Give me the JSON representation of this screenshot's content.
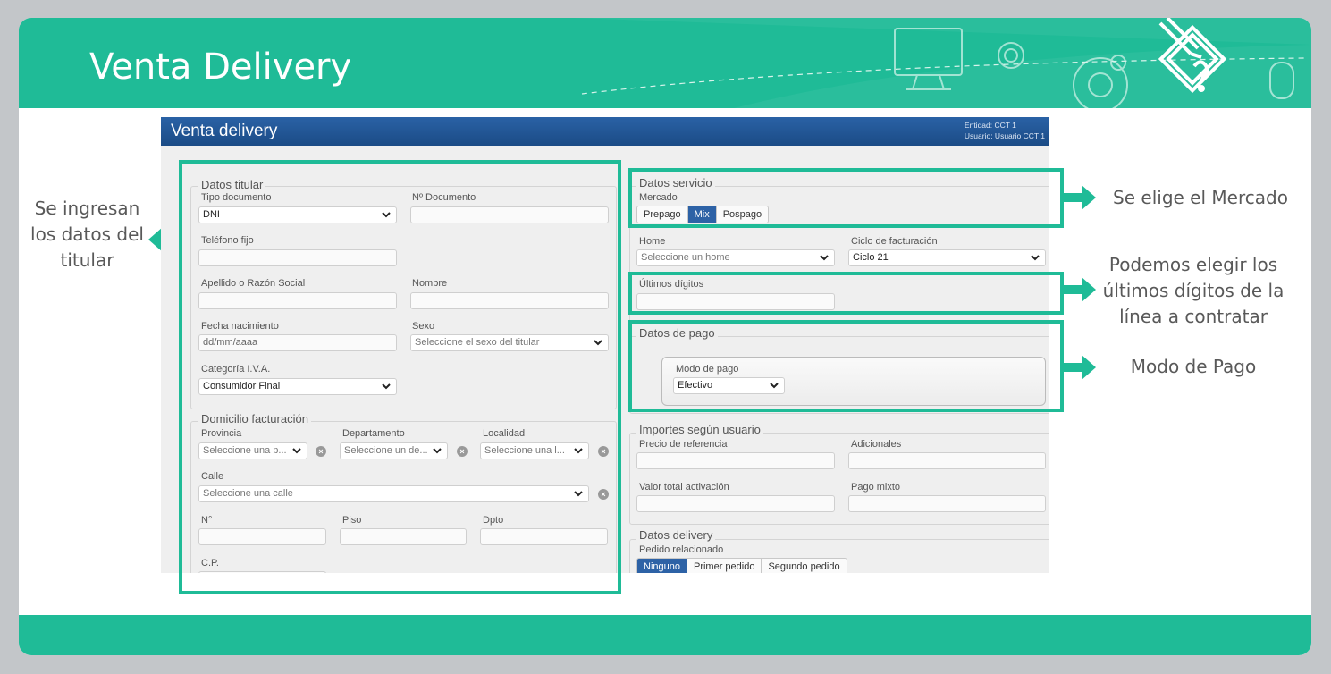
{
  "slide": {
    "title": "Venta Delivery",
    "annotations": {
      "titular": "Se ingresan los datos del titular",
      "mercado": "Se elige el Mercado",
      "digitos": "Podemos elegir los últimos dígitos de la línea a contratar",
      "pago": "Modo de Pago"
    },
    "colors": {
      "accent": "#1fbb97",
      "app_bar": "#1b4b86",
      "selected": "#2d62a6"
    }
  },
  "app": {
    "title": "Venta delivery",
    "entidad": "Entidad: CCT 1",
    "usuario": "Usuario: Usuario CCT 1",
    "titular": {
      "legend": "Datos titular",
      "tipo_doc_label": "Tipo documento",
      "tipo_doc_value": "DNI",
      "nro_doc_label": "Nº Documento",
      "telefono_label": "Teléfono fijo",
      "apellido_label": "Apellido o Razón Social",
      "nombre_label": "Nombre",
      "fecha_label": "Fecha nacimiento",
      "fecha_placeholder": "dd/mm/aaaa",
      "sexo_label": "Sexo",
      "sexo_placeholder": "Seleccione el sexo del titular",
      "iva_label": "Categoría I.V.A.",
      "iva_value": "Consumidor Final"
    },
    "domicilio": {
      "legend": "Domicilio facturación",
      "provincia_label": "Provincia",
      "provincia_placeholder": "Seleccione una p...",
      "departamento_label": "Departamento",
      "departamento_placeholder": "Seleccione un de...",
      "localidad_label": "Localidad",
      "localidad_placeholder": "Seleccione una l...",
      "calle_label": "Calle",
      "calle_placeholder": "Seleccione una calle",
      "nro_label": "N°",
      "piso_label": "Piso",
      "dpto_label": "Dpto",
      "cp_label": "C.P."
    },
    "servicio": {
      "legend": "Datos servicio",
      "mercado_label": "Mercado",
      "mercado_options": [
        "Prepago",
        "Mix",
        "Pospago"
      ],
      "mercado_selected": "Mix",
      "home_label": "Home",
      "home_placeholder": "Seleccione un home",
      "ciclo_label": "Ciclo de facturación",
      "ciclo_value": "Ciclo 21",
      "ultimos_label": "Últimos dígitos"
    },
    "pago": {
      "legend": "Datos de pago",
      "modo_label": "Modo de pago",
      "modo_value": "Efectivo"
    },
    "importes": {
      "legend": "Importes según usuario",
      "precio_label": "Precio de referencia",
      "adicionales_label": "Adicionales",
      "valor_label": "Valor total activación",
      "pago_mixto_label": "Pago mixto"
    },
    "delivery": {
      "legend": "Datos delivery",
      "pedido_label": "Pedido relacionado",
      "pedido_options": [
        "Ninguno",
        "Primer pedido",
        "Segundo pedido"
      ],
      "pedido_selected": "Ninguno"
    }
  }
}
